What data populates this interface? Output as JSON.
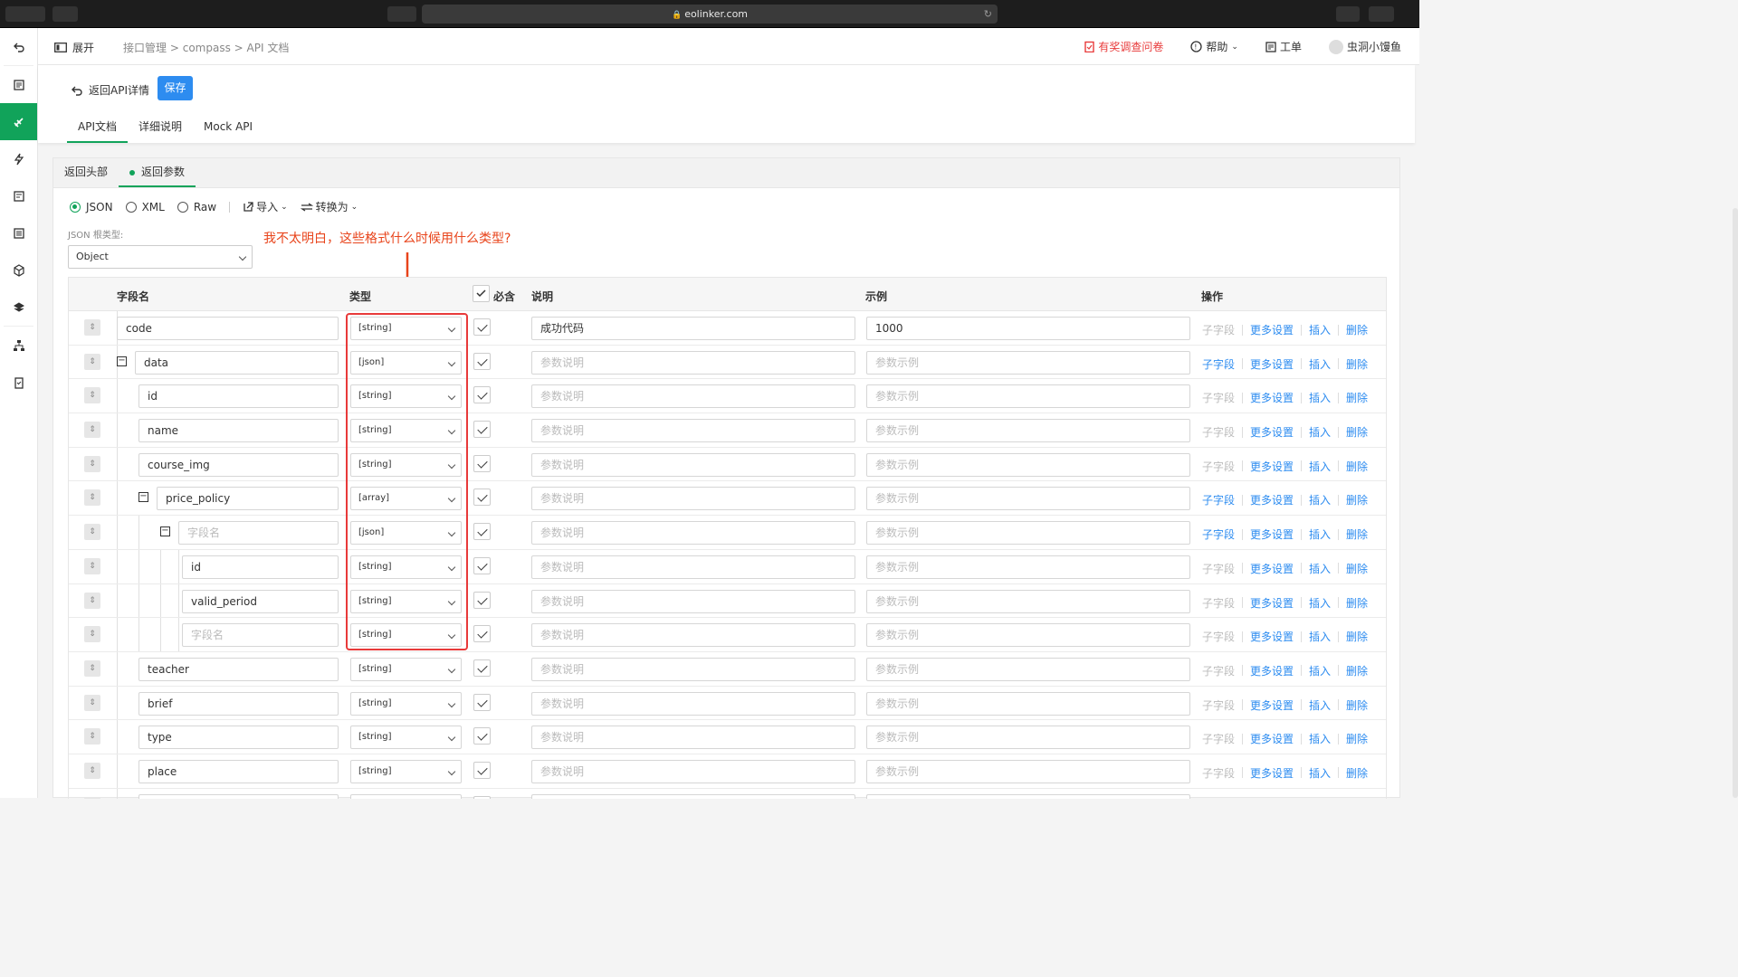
{
  "browser": {
    "url": "eolinker.com"
  },
  "header": {
    "expand_label": "展开",
    "breadcrumb": [
      "接口管理",
      "compass",
      "API 文档"
    ],
    "survey_label": "有奖调查问卷",
    "help_label": "帮助",
    "ticket_label": "工单",
    "user_name": "虫洞小馒鱼"
  },
  "subheader": {
    "back_label": "返回API详情",
    "save_label": "保存",
    "tabs": [
      "API文档",
      "详细说明",
      "Mock API"
    ]
  },
  "panel": {
    "tabs": [
      "返回头部",
      "返回参数"
    ],
    "formats": [
      "JSON",
      "XML",
      "Raw"
    ],
    "import_label": "导入",
    "convert_label": "转换为",
    "root_type_label": "JSON 根类型:",
    "root_type_value": "Object",
    "annotation": "我不太明白，这些格式什么时候用什么类型?"
  },
  "table": {
    "headers": {
      "field": "字段名",
      "type": "类型",
      "required": "必含",
      "desc": "说明",
      "example": "示例",
      "ops": "操作"
    },
    "ops": {
      "child": "子字段",
      "more": "更多设置",
      "insert": "插入",
      "delete": "删除"
    },
    "desc_placeholder": "参数说明",
    "example_placeholder": "参数示例",
    "field_placeholder": "字段名",
    "rows": [
      {
        "name": "code",
        "type": "[string]",
        "desc": "成功代码",
        "example": "1000",
        "level": 0,
        "toggle": false,
        "child_enabled": false
      },
      {
        "name": "data",
        "type": "[json]",
        "desc": "",
        "example": "",
        "level": 0,
        "toggle": true,
        "child_enabled": true
      },
      {
        "name": "id",
        "type": "[string]",
        "desc": "",
        "example": "",
        "level": 1,
        "toggle": false,
        "child_enabled": false
      },
      {
        "name": "name",
        "type": "[string]",
        "desc": "",
        "example": "",
        "level": 1,
        "toggle": false,
        "child_enabled": false
      },
      {
        "name": "course_img",
        "type": "[string]",
        "desc": "",
        "example": "",
        "level": 1,
        "toggle": false,
        "child_enabled": false
      },
      {
        "name": "price_policy",
        "type": "[array]",
        "desc": "",
        "example": "",
        "level": 1,
        "toggle": true,
        "child_enabled": true
      },
      {
        "name": "",
        "type": "[json]",
        "desc": "",
        "example": "",
        "level": 2,
        "toggle": true,
        "child_enabled": true
      },
      {
        "name": "id",
        "type": "[string]",
        "desc": "",
        "example": "",
        "level": 3,
        "toggle": false,
        "child_enabled": false
      },
      {
        "name": "valid_period",
        "type": "[string]",
        "desc": "",
        "example": "",
        "level": 3,
        "toggle": false,
        "child_enabled": false
      },
      {
        "name": "",
        "type": "[string]",
        "desc": "",
        "example": "",
        "level": 3,
        "toggle": false,
        "child_enabled": false
      },
      {
        "name": "teacher",
        "type": "[string]",
        "desc": "",
        "example": "",
        "level": 1,
        "toggle": false,
        "child_enabled": false
      },
      {
        "name": "brief",
        "type": "[string]",
        "desc": "",
        "example": "",
        "level": 1,
        "toggle": false,
        "child_enabled": false
      },
      {
        "name": "type",
        "type": "[string]",
        "desc": "",
        "example": "",
        "level": 1,
        "toggle": false,
        "child_enabled": false
      },
      {
        "name": "place",
        "type": "[string]",
        "desc": "",
        "example": "",
        "level": 1,
        "toggle": false,
        "child_enabled": false
      },
      {
        "name": "",
        "type": "",
        "desc": "",
        "example": "",
        "level": 1,
        "toggle": false,
        "child_enabled": false
      }
    ]
  },
  "colors": {
    "accent_green": "#11a35a",
    "link_blue": "#2d8cf0",
    "annotation_red": "#e83a3a"
  }
}
